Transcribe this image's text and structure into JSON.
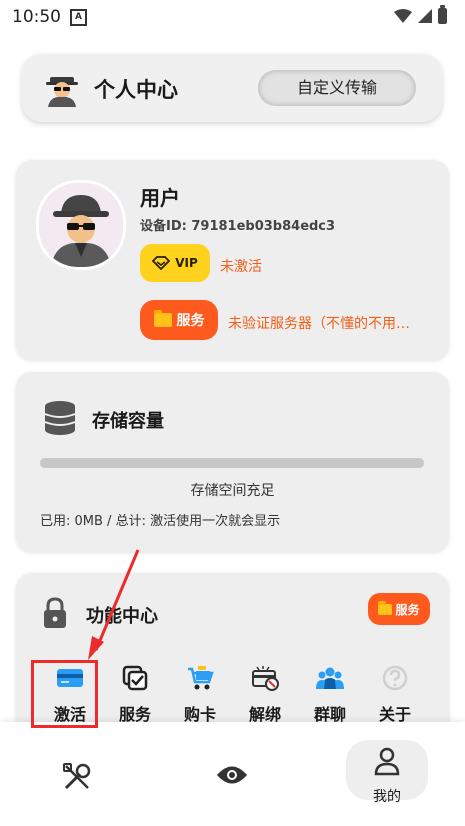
{
  "status_bar": {
    "time": "10:50",
    "indicator": "A"
  },
  "header": {
    "title": "个人中心",
    "button_label": "自定义传输",
    "icon": "spy-icon"
  },
  "user": {
    "name": "用户",
    "device_id": "设备ID: 79181eb03b84edc3",
    "vip_label": "VIP",
    "vip_status": "未激活",
    "service_label": "服务",
    "service_status": "未验证服务器（不懂的不用…"
  },
  "storage": {
    "title": "存储容量",
    "progress": 0,
    "status": "存储空间充足",
    "detail": "已用: 0MB / 总计: 激活使用一次就会显示"
  },
  "functions": {
    "title": "功能中心",
    "badge": "服务",
    "items": [
      {
        "label": "激活",
        "icon": "card-icon"
      },
      {
        "label": "服务",
        "icon": "checkbox-icon"
      },
      {
        "label": "购卡",
        "icon": "cart-icon"
      },
      {
        "label": "解绑",
        "icon": "unbind-icon"
      },
      {
        "label": "群聊",
        "icon": "group-icon"
      },
      {
        "label": "关于",
        "icon": "help-icon"
      }
    ]
  },
  "nav": {
    "tools_icon": "tools-icon",
    "eye_icon": "eye-icon",
    "mine_label": "我的"
  },
  "colors": {
    "accent_orange": "#ff5a1e",
    "vip_yellow": "#ffd21e",
    "annotation_red": "#ee2b2b"
  }
}
